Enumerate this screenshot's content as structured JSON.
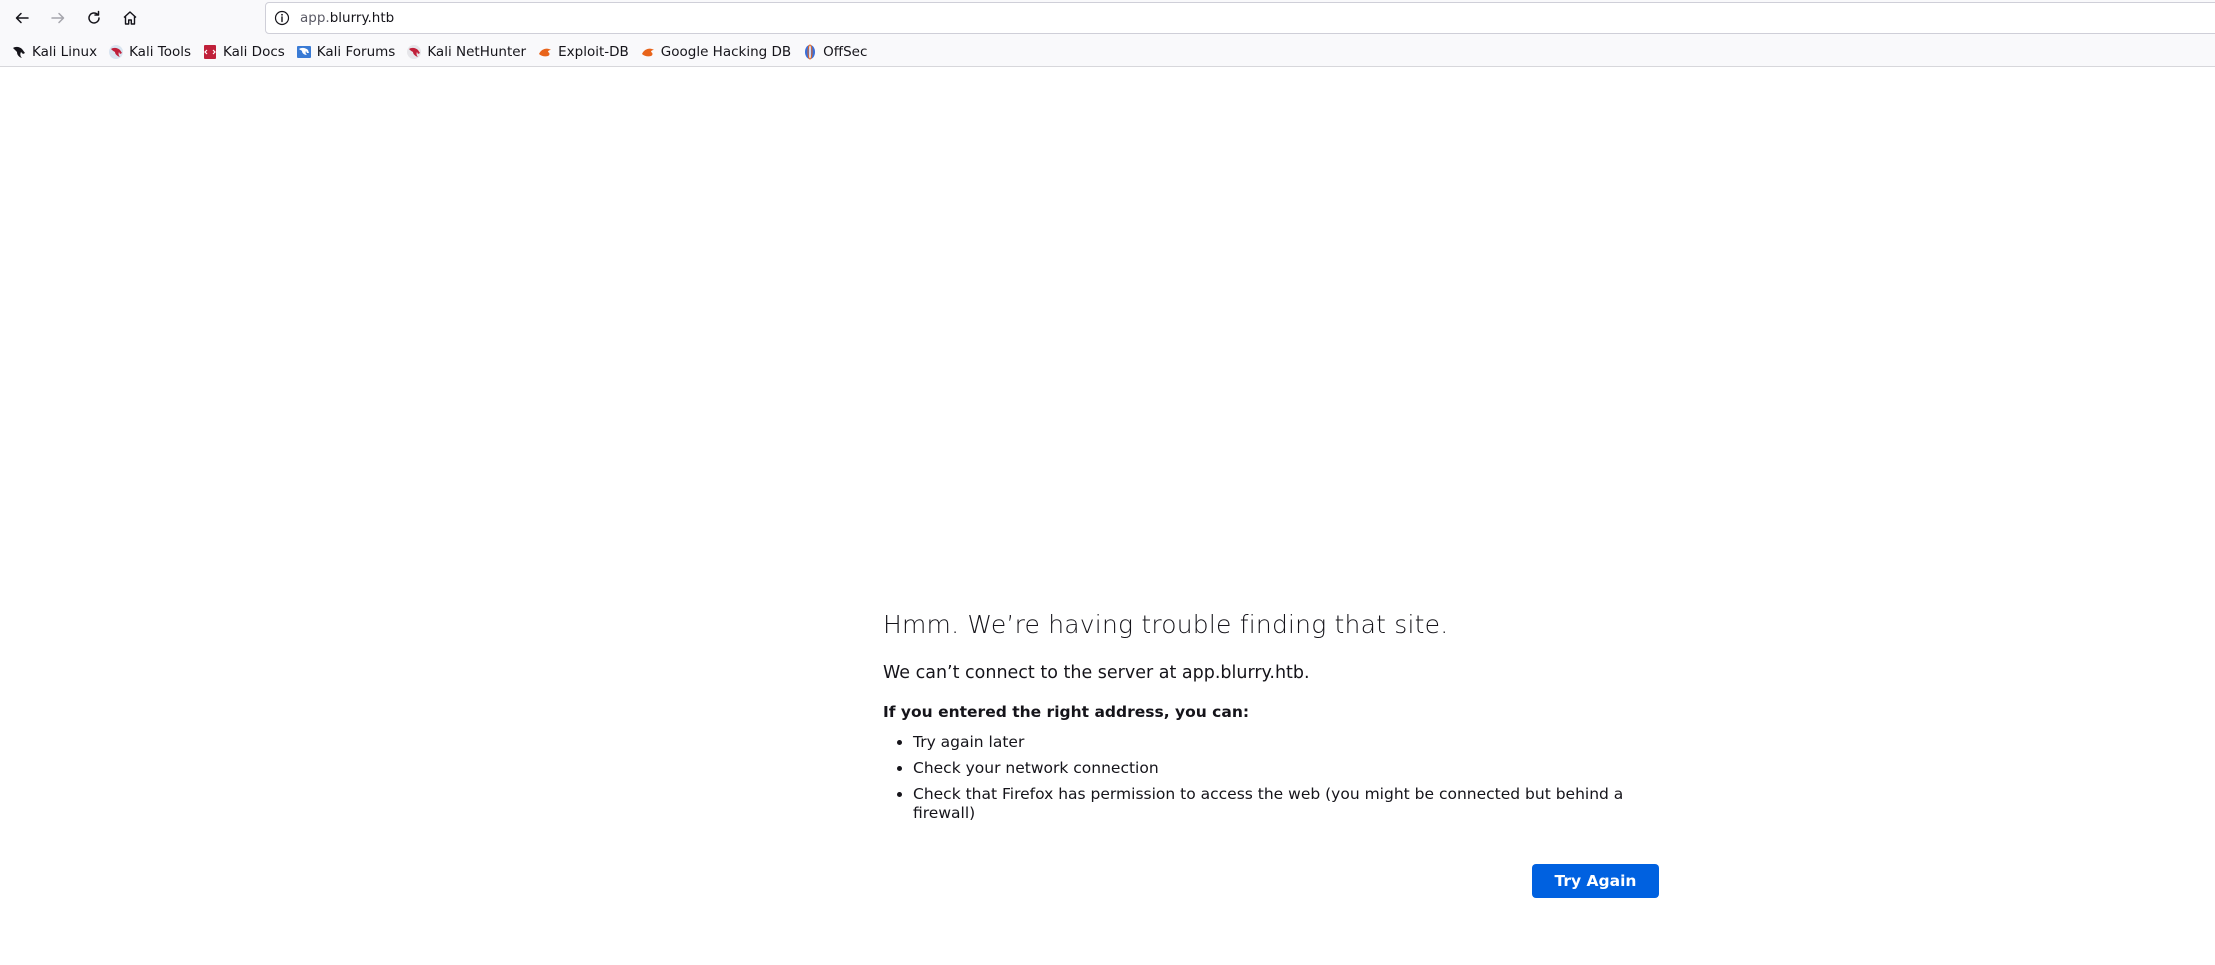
{
  "browser": {
    "url": {
      "prefix": "app.",
      "domain": "blurry.htb"
    },
    "nav": {
      "back_icon": "arrow-left-icon",
      "forward_icon": "arrow-right-icon",
      "reload_icon": "reload-icon",
      "home_icon": "home-icon",
      "info_icon": "info-icon"
    }
  },
  "bookmarks": [
    {
      "label": "Kali Linux",
      "icon": "kali-dragon-icon"
    },
    {
      "label": "Kali Tools",
      "icon": "kali-tools-icon"
    },
    {
      "label": "Kali Docs",
      "icon": "kali-docs-icon"
    },
    {
      "label": "Kali Forums",
      "icon": "kali-forums-icon"
    },
    {
      "label": "Kali NetHunter",
      "icon": "kali-nethunter-icon"
    },
    {
      "label": "Exploit-DB",
      "icon": "exploit-db-icon"
    },
    {
      "label": "Google Hacking DB",
      "icon": "ghdb-icon"
    },
    {
      "label": "OffSec",
      "icon": "offsec-icon"
    }
  ],
  "error_page": {
    "title": "Hmm. We’re having trouble finding that site.",
    "description": "We can’t connect to the server at app.blurry.htb.",
    "subheading": "If you entered the right address, you can:",
    "tips": [
      "Try again later",
      "Check your network connection",
      "Check that Firefox has permission to access the web (you might be connected but behind a firewall)"
    ],
    "try_again_label": "Try Again"
  },
  "colors": {
    "accent": "#0061e0",
    "toolbar_bg": "#f9f9fb",
    "text": "#15141a"
  }
}
